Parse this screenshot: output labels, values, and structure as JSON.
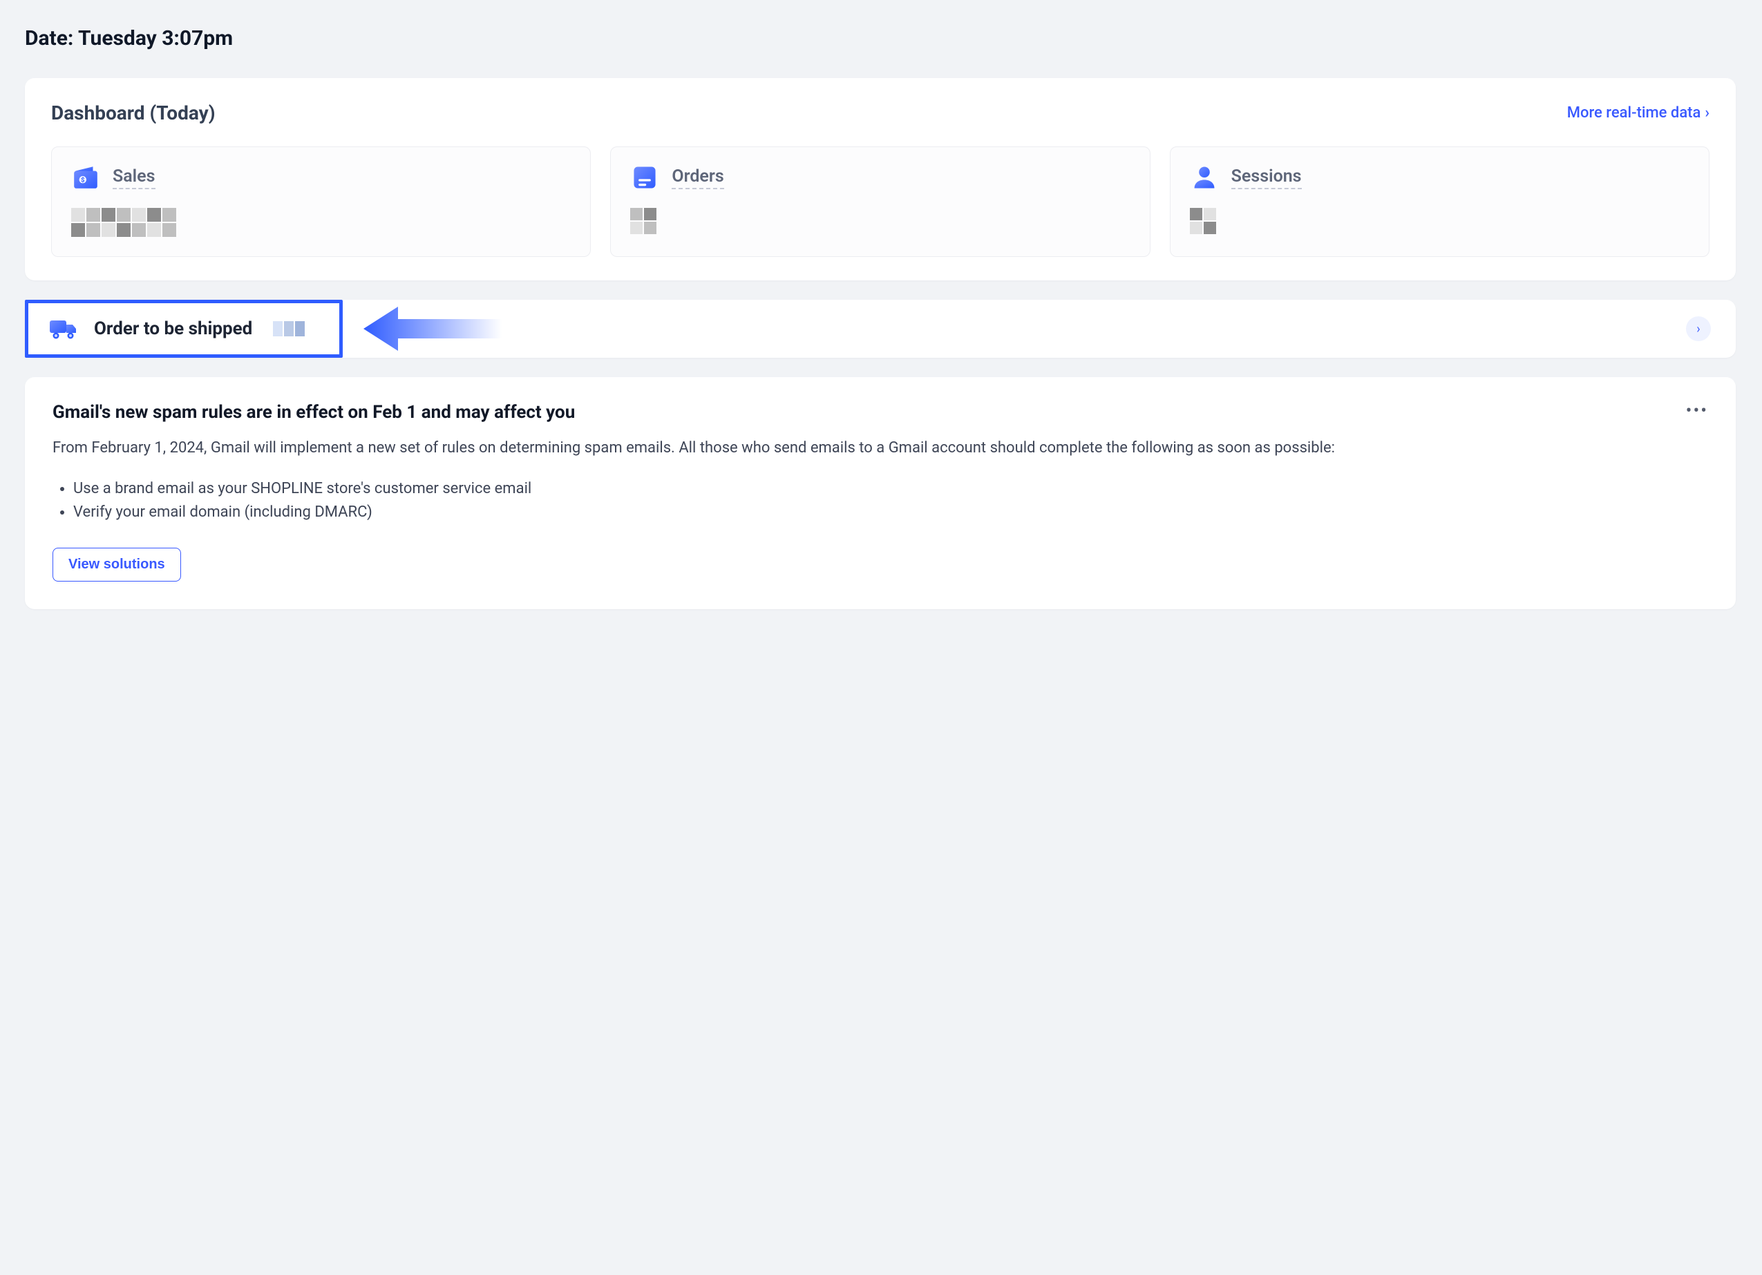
{
  "date_label": "Date: Tuesday 3:07pm",
  "dashboard": {
    "title": "Dashboard (Today)",
    "more_link": "More real-time data",
    "stats": [
      {
        "label": "Sales",
        "icon": "wallet-icon"
      },
      {
        "label": "Orders",
        "icon": "order-icon"
      },
      {
        "label": "Sessions",
        "icon": "person-icon"
      }
    ]
  },
  "shipping": {
    "title": "Order to be shipped"
  },
  "notice": {
    "title": "Gmail's new spam rules are in effect on Feb 1 and may affect you",
    "body": "From February 1, 2024, Gmail will implement a new set of rules on determining spam emails. All those who send emails to a Gmail account should complete the following as soon as possible:",
    "bullets": [
      "Use a brand email as your SHOPLINE store's customer service email",
      "Verify your email domain (including DMARC)"
    ],
    "cta": "View solutions"
  },
  "colors": {
    "primary": "#3959ff",
    "bg": "#f1f3f6",
    "card": "#ffffff",
    "text_muted": "#5e6679"
  }
}
